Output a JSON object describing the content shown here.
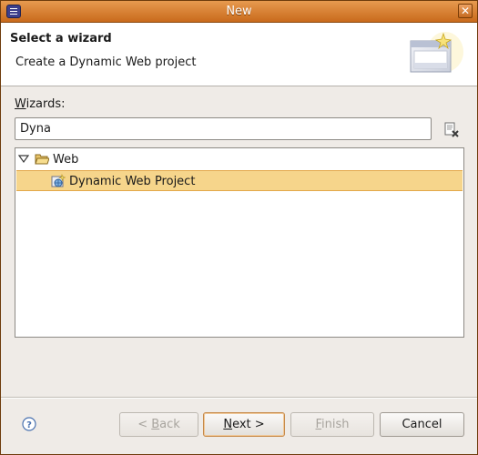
{
  "window": {
    "title": "New",
    "close_glyph": "✕"
  },
  "banner": {
    "title": "Select a wizard",
    "description": "Create a Dynamic Web project",
    "graphic_icon": "new-wizard-banner-icon"
  },
  "filter": {
    "label": "Wizards:",
    "label_mnemonic": "W",
    "label_rest": "izards:",
    "value": "Dyna",
    "clear_icon": "clear-filter-icon"
  },
  "tree": {
    "items": [
      {
        "label": "Web",
        "icon": "folder-open-icon",
        "expanded": true,
        "selected": false,
        "level": 0
      },
      {
        "label": "Dynamic Web Project",
        "icon": "web-project-icon",
        "expanded": false,
        "selected": true,
        "level": 1
      }
    ]
  },
  "footer": {
    "help_icon": "help-icon",
    "back": {
      "label": "< Back",
      "prefix": "< ",
      "mnemonic": "B",
      "rest": "ack",
      "enabled": false
    },
    "next": {
      "label": "Next >",
      "mnemonic": "N",
      "rest": "ext >",
      "enabled": true
    },
    "finish": {
      "label": "Finish",
      "mnemonic": "F",
      "rest": "inish",
      "enabled": false
    },
    "cancel": {
      "label": "Cancel",
      "enabled": true
    }
  },
  "colors": {
    "titlebar": "#d97c2f",
    "selection": "#f6d58b",
    "dialog_bg": "#efebe7"
  }
}
